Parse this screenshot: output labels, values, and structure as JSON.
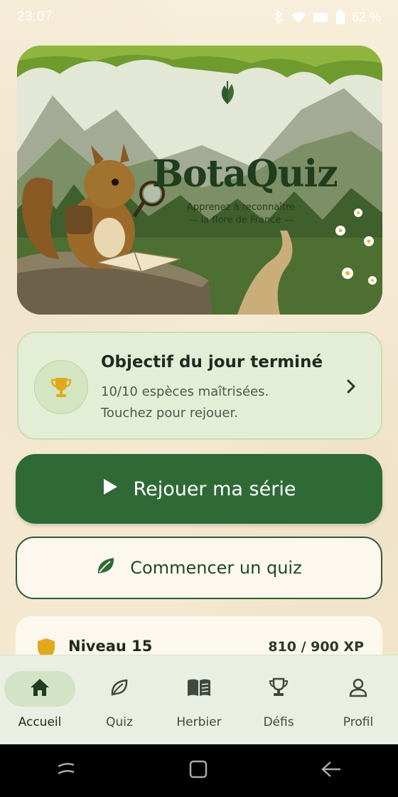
{
  "status_bar": {
    "time": "23:07",
    "battery": "62 %",
    "icons": [
      "bluetooth-icon",
      "wifi-icon",
      "signal-icon",
      "battery-icon"
    ]
  },
  "hero": {
    "title": "BotaQuiz",
    "subtitle_line1": "Apprenez à reconnaître",
    "subtitle_line2": "— la flore de France —"
  },
  "goal_card": {
    "title": "Objectif du jour terminé",
    "line1": "10/10 espèces maîtrisées.",
    "line2": "Touchez pour rejouer.",
    "icon": "trophy-icon"
  },
  "primary_button": {
    "label": "Rejouer ma série",
    "icon": "play-icon"
  },
  "secondary_button": {
    "label": "Commencer un quiz",
    "icon": "leaf-icon"
  },
  "level": {
    "label": "Niveau 15",
    "xp": "810 / 900 XP",
    "icon": "shield-icon"
  },
  "bottom_nav": {
    "items": [
      {
        "label": "Accueil",
        "icon": "home-icon",
        "active": true
      },
      {
        "label": "Quiz",
        "icon": "leaf-outline-icon",
        "active": false
      },
      {
        "label": "Herbier",
        "icon": "book-icon",
        "active": false
      },
      {
        "label": "Défis",
        "icon": "trophy-outline-icon",
        "active": false
      },
      {
        "label": "Profil",
        "icon": "person-icon",
        "active": false
      }
    ]
  },
  "colors": {
    "primary": "#2f6a36",
    "background": "#f6ecd7",
    "accent_gold": "#e0a91d",
    "card_green": "#e4eed7"
  }
}
